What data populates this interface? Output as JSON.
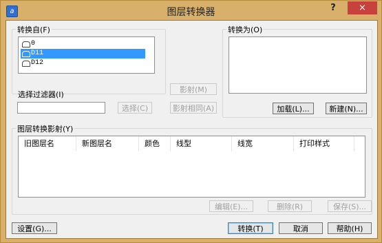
{
  "window": {
    "title": "图层转换器",
    "help": "?",
    "close": "×",
    "icon": "autocad-icon"
  },
  "convert_from": {
    "label": "转换自(F)",
    "layers": [
      {
        "name": "0",
        "selected": false
      },
      {
        "name": "D11",
        "selected": true
      },
      {
        "name": "D12",
        "selected": false
      }
    ],
    "filter_label": "选择过滤器(I)",
    "filter_value": "",
    "select_button": "选择(C)"
  },
  "middle": {
    "map_button": "影射(M)",
    "map_same_button": "影射相同(A)"
  },
  "convert_to": {
    "label": "转换为(O)",
    "load_button": "加载(L)...",
    "new_button": "新建(N)..."
  },
  "mapping": {
    "label": "图层转换影射(Y)",
    "columns": [
      "旧图层名",
      "新图层名",
      "颜色",
      "线型",
      "线宽",
      "打印样式"
    ],
    "edit_button": "编辑(E)...",
    "delete_button": "删除(R)",
    "save_button": "保存(S)..."
  },
  "footer": {
    "settings_button": "设置(G)...",
    "convert_button": "转换(T)",
    "cancel_button": "取消",
    "help_button": "帮助(H)"
  }
}
